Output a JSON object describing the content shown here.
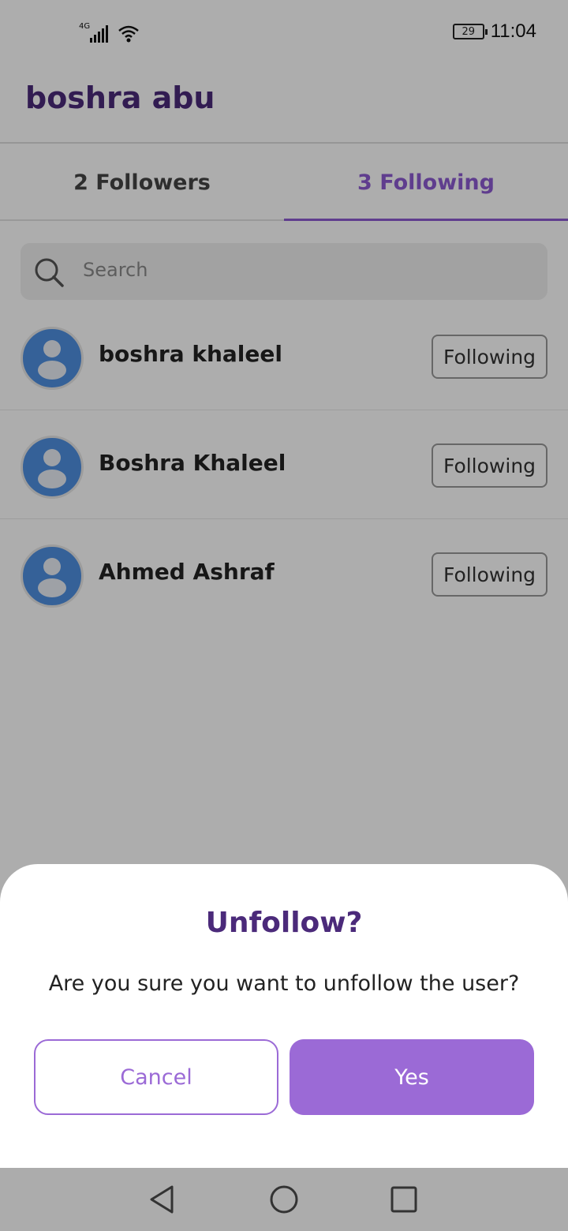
{
  "status_bar": {
    "network": "4G",
    "battery": "29",
    "time": "11:04"
  },
  "header": {
    "title": "boshra abu"
  },
  "tabs": {
    "followers_label": "2 Followers",
    "following_label": "3 Following",
    "active_color": "#8d5bd1"
  },
  "search": {
    "placeholder": "Search"
  },
  "following_list": [
    {
      "name": "boshra khaleel",
      "button": "Following"
    },
    {
      "name": "Boshra Khaleel",
      "button": "Following"
    },
    {
      "name": "Ahmed Ashraf",
      "button": "Following"
    }
  ],
  "dialog": {
    "title": "Unfollow?",
    "message": "Are you sure you want to unfollow the user?",
    "cancel_label": "Cancel",
    "confirm_label": "Yes",
    "accent_color": "#9b6ad6"
  },
  "nav_bar": {
    "icons": [
      "back-icon",
      "home-icon",
      "recents-icon"
    ]
  }
}
